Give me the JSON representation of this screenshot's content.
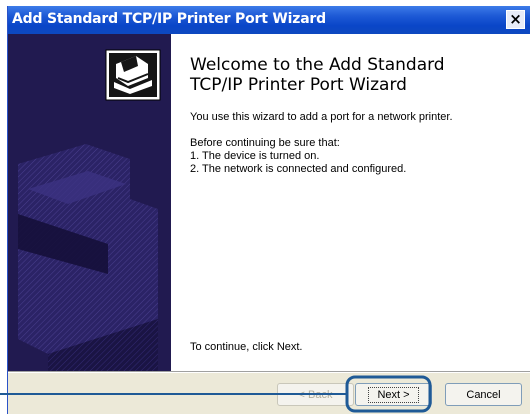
{
  "window": {
    "title": "Add Standard TCP/IP Printer Port Wizard"
  },
  "titlebar": {
    "close_label": "×"
  },
  "content": {
    "heading_line1": "Welcome to the Add Standard",
    "heading_line2": "TCP/IP Printer Port Wizard",
    "intro": "You use this wizard to add a port for a network printer.",
    "before": "Before continuing be sure that:",
    "item1": "1.  The device is turned on.",
    "item2": "2.  The network is connected and configured.",
    "continue": "To continue, click Next."
  },
  "buttons": {
    "back": "< Back",
    "next": "Next >",
    "cancel": "Cancel"
  },
  "colors": {
    "titlebar": "#0a46c8",
    "panel": "#211a50",
    "callout": "#1f5a96",
    "dialog": "#ece9d8"
  },
  "icons": {
    "close": "close-icon",
    "wizard_graphic": "printer-wizard-icon",
    "callout": "highlight-callout"
  }
}
